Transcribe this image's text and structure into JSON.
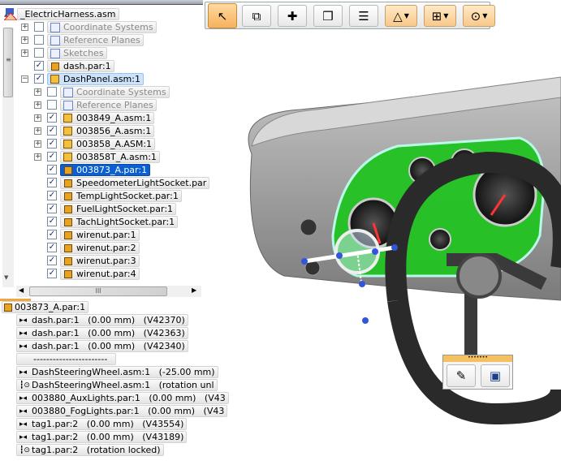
{
  "tree": {
    "root": "_ElectricHarness.asm",
    "items": [
      {
        "label": "Coordinate Systems",
        "level": 1,
        "expander": "+",
        "checked": false,
        "dim": true,
        "icon": "coordinate-systems-icon"
      },
      {
        "label": "Reference Planes",
        "level": 1,
        "expander": "+",
        "checked": false,
        "dim": true,
        "icon": "reference-planes-icon"
      },
      {
        "label": "Sketches",
        "level": 1,
        "expander": "+",
        "checked": false,
        "dim": true,
        "icon": "sketches-icon"
      },
      {
        "label": "dash.par:1",
        "level": 1,
        "expander": "",
        "checked": true,
        "icon": "part-icon"
      },
      {
        "label": "DashPanel.asm:1",
        "level": 1,
        "expander": "−",
        "checked": true,
        "icon": "assembly-icon",
        "state": "highlight"
      },
      {
        "label": "Coordinate Systems",
        "level": 2,
        "expander": "+",
        "checked": false,
        "dim": true,
        "icon": "coordinate-systems-icon"
      },
      {
        "label": "Reference Planes",
        "level": 2,
        "expander": "+",
        "checked": false,
        "dim": true,
        "icon": "reference-planes-icon"
      },
      {
        "label": "003849_A.asm:1",
        "level": 2,
        "expander": "+",
        "checked": true,
        "icon": "assembly-icon"
      },
      {
        "label": "003856_A.asm:1",
        "level": 2,
        "expander": "+",
        "checked": true,
        "icon": "assembly-icon"
      },
      {
        "label": "003858_A.ASM:1",
        "level": 2,
        "expander": "+",
        "checked": true,
        "icon": "assembly-icon"
      },
      {
        "label": "003858T_A.asm:1",
        "level": 2,
        "expander": "+",
        "checked": true,
        "icon": "assembly-icon"
      },
      {
        "label": "003873_A.par:1",
        "level": 2,
        "expander": "",
        "checked": true,
        "icon": "part-icon",
        "state": "selected"
      },
      {
        "label": "SpeedometerLightSocket.par",
        "level": 2,
        "expander": "",
        "checked": true,
        "icon": "part-icon"
      },
      {
        "label": "TempLightSocket.par:1",
        "level": 2,
        "expander": "",
        "checked": true,
        "icon": "part-icon"
      },
      {
        "label": "FuelLightSocket.par:1",
        "level": 2,
        "expander": "",
        "checked": true,
        "icon": "part-icon"
      },
      {
        "label": "TachLightSocket.par:1",
        "level": 2,
        "expander": "",
        "checked": true,
        "icon": "part-icon"
      },
      {
        "label": "wirenut.par:1",
        "level": 2,
        "expander": "",
        "checked": true,
        "icon": "part-icon"
      },
      {
        "label": "wirenut.par:2",
        "level": 2,
        "expander": "",
        "checked": true,
        "icon": "part-icon"
      },
      {
        "label": "wirenut.par:3",
        "level": 2,
        "expander": "",
        "checked": true,
        "icon": "part-icon"
      },
      {
        "label": "wirenut.par:4",
        "level": 2,
        "expander": "",
        "checked": true,
        "icon": "part-icon"
      }
    ],
    "hscroll_grip": "III"
  },
  "relationships": {
    "header": "003873_A.par:1",
    "items": [
      {
        "label": "dash.par:1   (0.00 mm)   (V42370)",
        "icon": "mate-icon"
      },
      {
        "label": "dash.par:1   (0.00 mm)   (V42363)",
        "icon": "mate-icon"
      },
      {
        "label": "dash.par:1   (0.00 mm)   (V42340)",
        "icon": "mate-icon"
      },
      {
        "label": "-----------------------",
        "icon": ""
      },
      {
        "label": "DashSteeringWheel.asm:1   (-25.00 mm)",
        "icon": "mate-icon"
      },
      {
        "label": "DashSteeringWheel.asm:1   (rotation unl",
        "icon": "axial-align-icon"
      },
      {
        "label": "003880_AuxLights.par:1   (0.00 mm)   (V43",
        "icon": "mate-icon"
      },
      {
        "label": "003880_FogLights.par:1   (0.00 mm)   (V43",
        "icon": "mate-icon"
      },
      {
        "label": "tag1.par:2   (0.00 mm)   (V43554)",
        "icon": "mate-icon"
      },
      {
        "label": "tag1.par:2   (0.00 mm)   (V43189)",
        "icon": "mate-icon"
      },
      {
        "label": "tag1.par:2   (rotation locked)",
        "icon": "axial-align-icon"
      }
    ]
  },
  "toolbar": {
    "buttons": [
      {
        "name": "select-tool-button",
        "icon": "select-arrow-icon",
        "active": true
      },
      {
        "name": "copy-button",
        "icon": "overlap-squares-icon"
      },
      {
        "name": "add-part-button",
        "icon": "add-part-icon"
      },
      {
        "name": "select-parts-button",
        "icon": "pick-parts-icon"
      },
      {
        "name": "list-button",
        "icon": "list-icon"
      },
      {
        "name": "move-dropdown",
        "icon": "triangle-move-icon",
        "dropdown": true
      },
      {
        "name": "flow-dropdown",
        "icon": "flow-icon",
        "dropdown": true
      },
      {
        "name": "constraint-dropdown",
        "icon": "point-circle-icon",
        "dropdown": true
      }
    ]
  },
  "mini_toolbar": {
    "buttons": [
      {
        "name": "edit-part-button",
        "icon": "pencil-part-icon"
      },
      {
        "name": "view-button",
        "icon": "window-icon"
      }
    ]
  },
  "colors": {
    "selection": "#0b5fd1",
    "highlight": "#cde3fb",
    "panel_green": "#22c322",
    "accent_orange": "#f6b25c"
  }
}
